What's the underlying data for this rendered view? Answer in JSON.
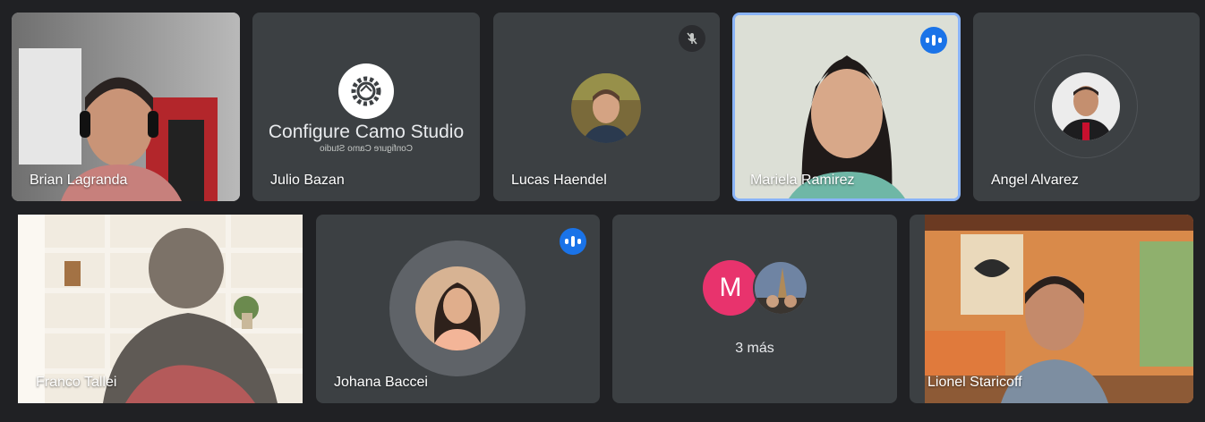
{
  "participants": [
    {
      "name": "Brian Lagranda"
    },
    {
      "name": "Julio Bazan",
      "placeholder_title": "Configure Camo Studio",
      "placeholder_subtitle": "Configure Camo Studio"
    },
    {
      "name": "Lucas Haendel",
      "mic": "muted"
    },
    {
      "name": "Mariela Ramirez",
      "mic": "speaking"
    },
    {
      "name": "Angel Alvarez"
    },
    {
      "name": "Franco Tallei"
    },
    {
      "name": "Johana Baccei",
      "mic": "speaking"
    },
    {
      "overflow_initial": "M",
      "overflow_label": "3 más"
    },
    {
      "name": "Lionel Staricoff"
    }
  ],
  "colors": {
    "background": "#202124",
    "tile": "#3c4043",
    "active_border": "#8ab4f8",
    "speaking_badge": "#1a73e8",
    "initial_avatar": "#e8336d"
  }
}
